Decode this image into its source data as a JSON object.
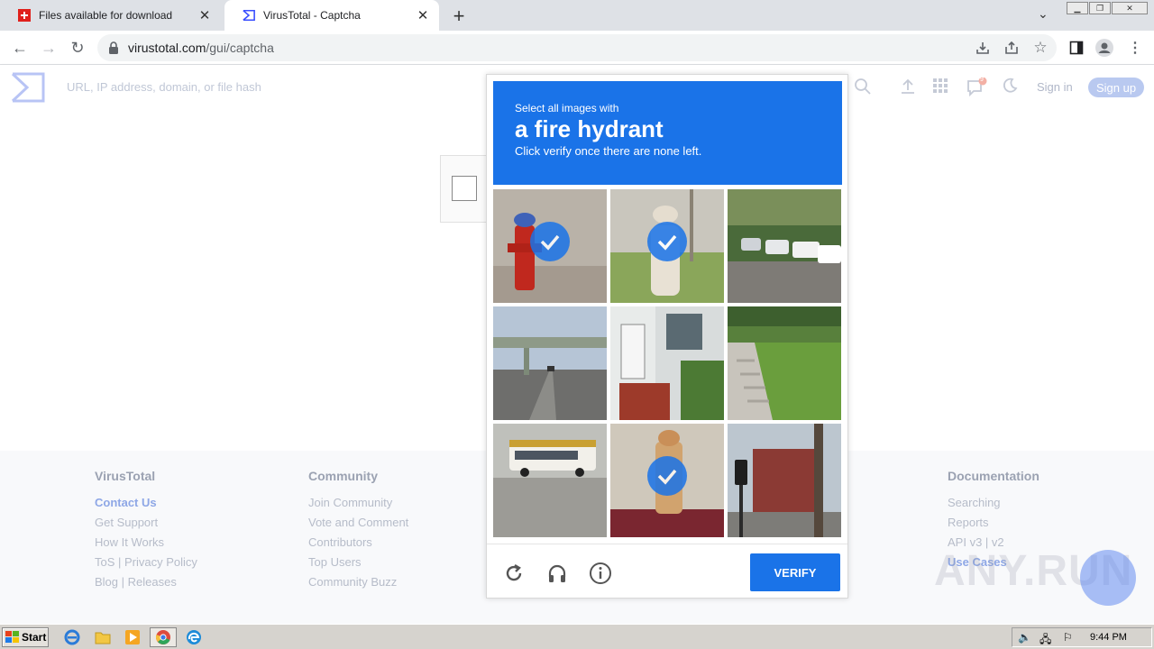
{
  "browser": {
    "tabs": [
      {
        "title": "Files available for download",
        "active": false
      },
      {
        "title": "VirusTotal - Captcha",
        "active": true
      }
    ],
    "url_host": "virustotal.com",
    "url_path": "/gui/captcha"
  },
  "vt": {
    "search_placeholder": "URL, IP address, domain, or file hash",
    "signin": "Sign in",
    "signup": "Sign up",
    "notification_count": "9"
  },
  "captcha": {
    "prompt_pre": "Select all images with",
    "prompt_target": "a fire hydrant",
    "prompt_post": "Click verify once there are none left.",
    "verify_label": "VERIFY",
    "tiles": [
      {
        "scene": "red fire hydrant",
        "selected": true
      },
      {
        "scene": "white fire hydrant",
        "selected": true
      },
      {
        "scene": "parked cars on street",
        "selected": false
      },
      {
        "scene": "highway overpass",
        "selected": false
      },
      {
        "scene": "house with red stairs",
        "selected": false
      },
      {
        "scene": "grass slope with steps",
        "selected": false
      },
      {
        "scene": "school bus",
        "selected": false
      },
      {
        "scene": "yellow fire hydrant",
        "selected": true
      },
      {
        "scene": "traffic light at corner",
        "selected": false
      }
    ]
  },
  "footer": {
    "columns": [
      {
        "head": "VirusTotal",
        "links": [
          "Contact Us",
          "Get Support",
          "How It Works",
          "ToS | Privacy Policy",
          "Blog | Releases"
        ]
      },
      {
        "head": "Community",
        "links": [
          "Join Community",
          "Vote and Comment",
          "Contributors",
          "Top Users",
          "Community Buzz"
        ]
      },
      {
        "head": "Documentation",
        "links": [
          "Searching",
          "Reports",
          "API v3 | v2",
          "Use Cases"
        ]
      }
    ]
  },
  "watermark": "ANY.RUN",
  "taskbar": {
    "start_label": "Start",
    "clock": "9:44 PM"
  }
}
